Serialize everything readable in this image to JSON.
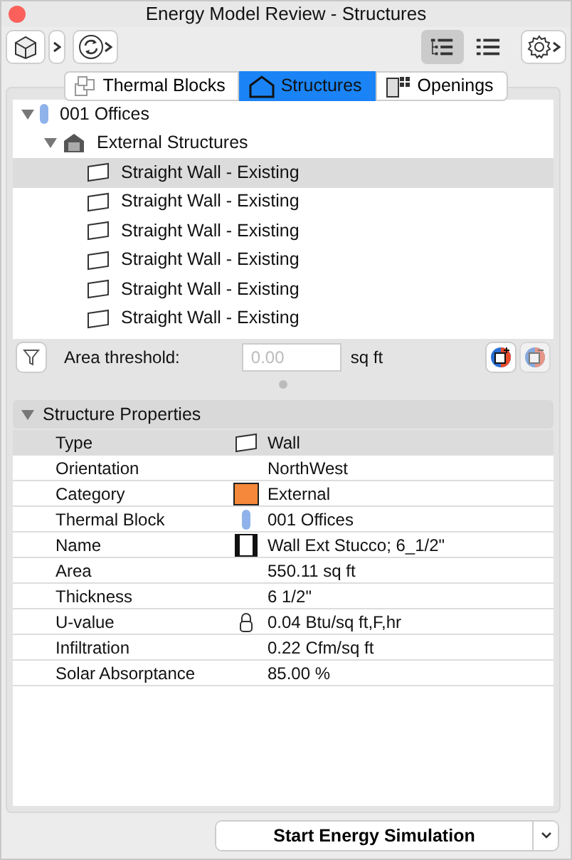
{
  "window": {
    "title": "Energy Model Review - Structures"
  },
  "view_toggles": [
    {
      "kind": "tree",
      "selected": true
    },
    {
      "kind": "list",
      "selected": false
    }
  ],
  "tabs": [
    {
      "label": "Thermal Blocks",
      "kind": "blocks",
      "selected": false
    },
    {
      "label": "Structures",
      "kind": "structures",
      "selected": true
    },
    {
      "label": "Openings",
      "kind": "openings",
      "selected": false
    }
  ],
  "tree": [
    {
      "label": "001 Offices",
      "kind": "block",
      "expanded": true,
      "selected": false,
      "children": [
        {
          "label": "External Structures",
          "kind": "group",
          "expanded": true,
          "selected": false,
          "children": [
            {
              "label": "Straight Wall - Existing",
              "kind": "wall",
              "selected": true
            },
            {
              "label": "Straight Wall - Existing",
              "kind": "wall",
              "selected": false
            },
            {
              "label": "Straight Wall - Existing",
              "kind": "wall",
              "selected": false
            },
            {
              "label": "Straight Wall - Existing",
              "kind": "wall",
              "selected": false
            },
            {
              "label": "Straight Wall - Existing",
              "kind": "wall",
              "selected": false
            },
            {
              "label": "Straight Wall - Existing",
              "kind": "wall",
              "selected": false
            }
          ]
        }
      ]
    }
  ],
  "filter": {
    "label": "Area threshold:",
    "placeholder": "0.00",
    "unit": "sq ft"
  },
  "properties": {
    "title": "Structure Properties",
    "expanded": true,
    "rows": [
      {
        "label": "Type",
        "value": "Wall",
        "kind": "wall",
        "selected": true
      },
      {
        "label": "Orientation",
        "value": "NorthWest",
        "selected": false
      },
      {
        "label": "Category",
        "value": "External",
        "kind": "swatch",
        "color": "#f5883a",
        "selected": false
      },
      {
        "label": "Thermal Block",
        "value": "001 Offices",
        "kind": "block",
        "selected": false
      },
      {
        "label": "Name",
        "value": "Wall Ext Stucco; 6_1/2\"",
        "kind": "material",
        "selected": false
      },
      {
        "label": "Area",
        "value": "550.11 sq ft",
        "selected": false
      },
      {
        "label": "Thickness",
        "value": "6 1/2\"",
        "selected": false
      },
      {
        "label": "U-value",
        "value": "0.04 Btu/sq ft,F,hr",
        "kind": "lock",
        "selected": false
      },
      {
        "label": "Infiltration",
        "value": "0.22 Cfm/sq ft",
        "selected": false
      },
      {
        "label": "Solar Absorptance",
        "value": "85.00 %",
        "selected": false
      }
    ]
  },
  "action": {
    "label": "Start Energy Simulation"
  }
}
